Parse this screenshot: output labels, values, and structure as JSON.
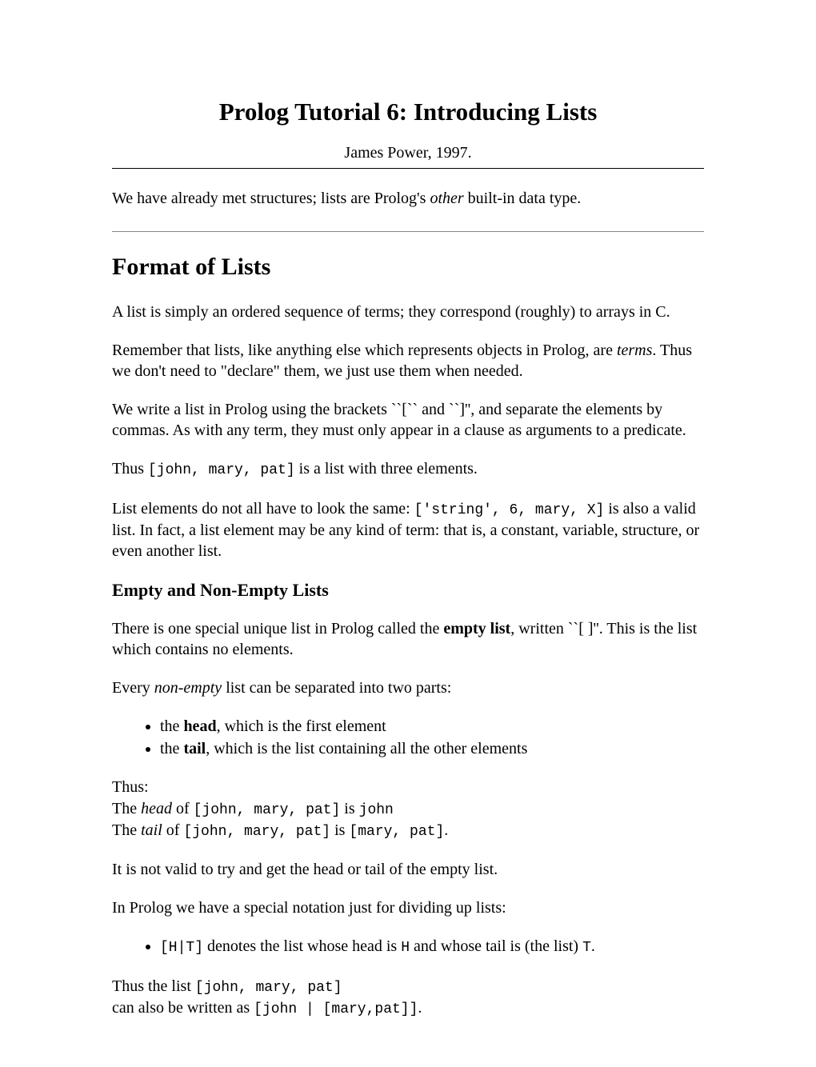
{
  "title": "Prolog Tutorial 6: Introducing Lists",
  "byline": "James Power, 1997.",
  "intro": {
    "a": "We have already met structures; lists are Prolog's ",
    "em": "other",
    "b": " built-in data type."
  },
  "h2_format": "Format of Lists",
  "p_format_1": "A list is simply an ordered sequence of terms; they correspond (roughly) to arrays in C.",
  "p_format_2": {
    "a": "Remember that lists, like anything else which represents objects in Prolog, are ",
    "em": "terms",
    "b": ". Thus we don't need to \"declare\" them, we just use them when needed."
  },
  "p_format_3": "We write a list in Prolog using the brackets ``[`` and ``]'', and separate the elements by commas. As with any term, they must only appear in a clause as arguments to a predicate.",
  "p_format_4": {
    "a": "Thus ",
    "code": "[john, mary, pat]",
    "b": " is a list with three elements."
  },
  "p_format_5": {
    "a": "List elements do not all have to look the same: ",
    "code": "['string', 6, mary, X]",
    "b": " is also a valid list. In fact, a list element may be any kind of term: that is, a constant, variable, structure, or even another list."
  },
  "h3_empty": "Empty and Non-Empty Lists",
  "p_empty_1": {
    "a": "There is one special unique list in Prolog called the ",
    "strong": "empty list",
    "b": ", written ``[ ]''. This is the list which contains no elements."
  },
  "p_empty_2": {
    "a": "Every ",
    "em": "non-empty",
    "b": " list can be separated into two parts:"
  },
  "bullets1": {
    "b1": {
      "a": "the ",
      "strong": "head",
      "b": ", which is the first element"
    },
    "b2": {
      "a": "the ",
      "strong": "tail",
      "b": ", which is the list containing all the other elements"
    }
  },
  "thus": {
    "label": "Thus:",
    "l1": {
      "a": "The ",
      "em": "head",
      "b": " of ",
      "code1": "[john, mary, pat]",
      "c": " is ",
      "code2": "john"
    },
    "l2": {
      "a": "The ",
      "em": "tail",
      "b": " of ",
      "code1": "[john, mary, pat]",
      "c": " is ",
      "code2": "[mary, pat]",
      "d": "."
    }
  },
  "p_invalid": "It is not valid to try and get the head or tail of the empty list.",
  "p_notation": "In Prolog we have a special notation just for dividing up lists:",
  "bullets2": {
    "b1": {
      "code1": "[H|T]",
      "a": " denotes the list whose head is ",
      "code2": "H",
      "b": " and whose tail is (the list) ",
      "code3": "T",
      "c": "."
    }
  },
  "p_rewrite": {
    "a": "Thus the list ",
    "code1": "[john, mary, pat]",
    "br": "can also be written as ",
    "code2": "[john | [mary,pat]]",
    "c": "."
  }
}
